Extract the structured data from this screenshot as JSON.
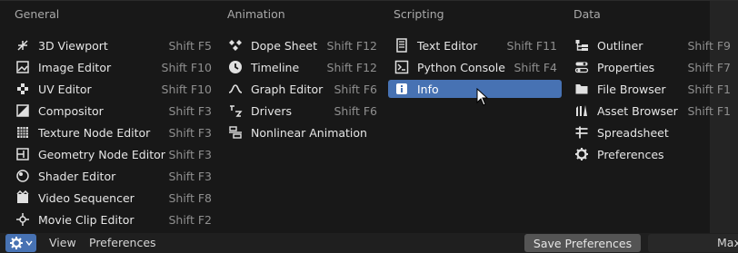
{
  "columns": [
    {
      "heading": "General",
      "items": [
        {
          "label": "3D Viewport",
          "shortcut": "Shift F5",
          "icon": "3d-viewport-icon"
        },
        {
          "label": "Image Editor",
          "shortcut": "Shift F10",
          "icon": "image-editor-icon"
        },
        {
          "label": "UV Editor",
          "shortcut": "Shift F10",
          "icon": "uv-editor-icon"
        },
        {
          "label": "Compositor",
          "shortcut": "Shift F3",
          "icon": "compositor-icon"
        },
        {
          "label": "Texture Node Editor",
          "shortcut": "Shift F3",
          "icon": "texture-node-icon"
        },
        {
          "label": "Geometry Node Editor",
          "shortcut": "Shift F3",
          "icon": "geometry-node-icon"
        },
        {
          "label": "Shader Editor",
          "shortcut": "Shift F3",
          "icon": "shader-editor-icon"
        },
        {
          "label": "Video Sequencer",
          "shortcut": "Shift F8",
          "icon": "video-sequencer-icon"
        },
        {
          "label": "Movie Clip Editor",
          "shortcut": "Shift F2",
          "icon": "movie-clip-icon"
        }
      ]
    },
    {
      "heading": "Animation",
      "items": [
        {
          "label": "Dope Sheet",
          "shortcut": "Shift F12",
          "icon": "dope-sheet-icon"
        },
        {
          "label": "Timeline",
          "shortcut": "Shift F12",
          "icon": "timeline-icon"
        },
        {
          "label": "Graph Editor",
          "shortcut": "Shift F6",
          "icon": "graph-editor-icon"
        },
        {
          "label": "Drivers",
          "shortcut": "Shift F6",
          "icon": "drivers-icon"
        },
        {
          "label": "Nonlinear Animation",
          "shortcut": "",
          "icon": "nla-icon"
        }
      ]
    },
    {
      "heading": "Scripting",
      "items": [
        {
          "label": "Text Editor",
          "shortcut": "Shift F11",
          "icon": "text-editor-icon"
        },
        {
          "label": "Python Console",
          "shortcut": "Shift F4",
          "icon": "python-console-icon"
        },
        {
          "label": "Info",
          "shortcut": "",
          "icon": "info-icon",
          "active": true
        }
      ]
    },
    {
      "heading": "Data",
      "items": [
        {
          "label": "Outliner",
          "shortcut": "Shift F9",
          "icon": "outliner-icon"
        },
        {
          "label": "Properties",
          "shortcut": "Shift F7",
          "icon": "properties-icon"
        },
        {
          "label": "File Browser",
          "shortcut": "Shift F1",
          "icon": "file-browser-icon"
        },
        {
          "label": "Asset Browser",
          "shortcut": "Shift F1",
          "icon": "asset-browser-icon"
        },
        {
          "label": "Spreadsheet",
          "shortcut": "",
          "icon": "spreadsheet-icon"
        },
        {
          "label": "Preferences",
          "shortcut": "",
          "icon": "preferences-icon"
        }
      ]
    }
  ],
  "footer": {
    "menu_view": "View",
    "menu_preferences": "Preferences",
    "save_button": "Save Preferences",
    "right_label": "Max"
  },
  "colors": {
    "accent": "#4772b3",
    "background": "#181818"
  }
}
